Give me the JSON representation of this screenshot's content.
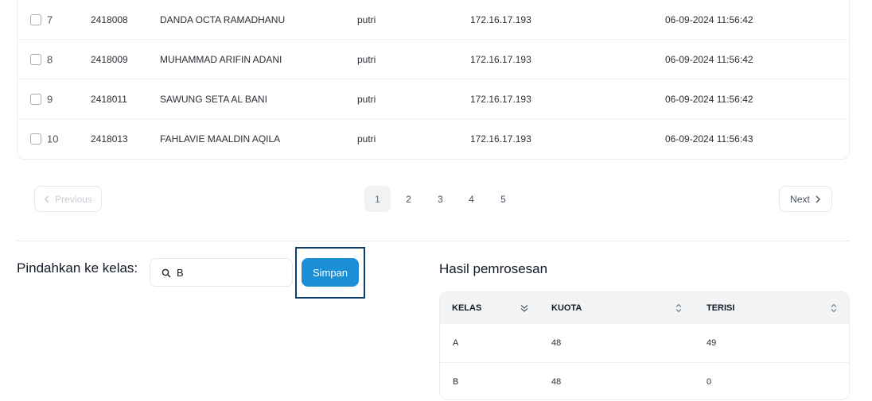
{
  "students": [
    {
      "no": "7",
      "id": "2418008",
      "name": "DANDA OCTA RAMADHANU",
      "user": "putri",
      "ip": "172.16.17.193",
      "time": "06-09-2024 11:56:42"
    },
    {
      "no": "8",
      "id": "2418009",
      "name": "MUHAMMAD ARIFIN ADANI",
      "user": "putri",
      "ip": "172.16.17.193",
      "time": "06-09-2024 11:56:42"
    },
    {
      "no": "9",
      "id": "2418011",
      "name": "SAWUNG SETA AL BANI",
      "user": "putri",
      "ip": "172.16.17.193",
      "time": "06-09-2024 11:56:42"
    },
    {
      "no": "10",
      "id": "2418013",
      "name": "FAHLAVIE MAALDIN AQILA",
      "user": "putri",
      "ip": "172.16.17.193",
      "time": "06-09-2024 11:56:43"
    }
  ],
  "pagination": {
    "prev_label": "Previous",
    "next_label": "Next",
    "pages": [
      "1",
      "2",
      "3",
      "4",
      "5"
    ],
    "current": "1"
  },
  "move": {
    "label": "Pindahkan ke kelas:",
    "search_value": "B",
    "save_label": "Simpan"
  },
  "results": {
    "title": "Hasil pemrosesan",
    "headers": [
      "KELAS",
      "KUOTA",
      "TERISI"
    ],
    "rows": [
      {
        "kelas": "A",
        "kuota": "48",
        "terisi": "49"
      },
      {
        "kelas": "B",
        "kuota": "48",
        "terisi": "0"
      }
    ]
  },
  "colors": {
    "accent": "#1a8fd6",
    "highlight_frame": "#0f3d6e"
  }
}
